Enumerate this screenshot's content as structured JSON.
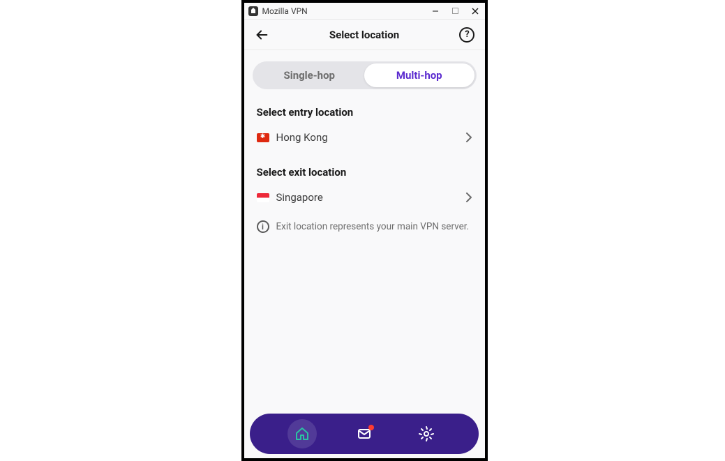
{
  "titlebar": {
    "app_name": "Mozilla VPN"
  },
  "header": {
    "title": "Select location"
  },
  "tabs": {
    "single_hop": "Single-hop",
    "multi_hop": "Multi-hop"
  },
  "entry": {
    "label": "Select entry location",
    "location": "Hong Kong"
  },
  "exit": {
    "label": "Select exit location",
    "location": "Singapore"
  },
  "info": {
    "text": "Exit location represents your main VPN server."
  }
}
